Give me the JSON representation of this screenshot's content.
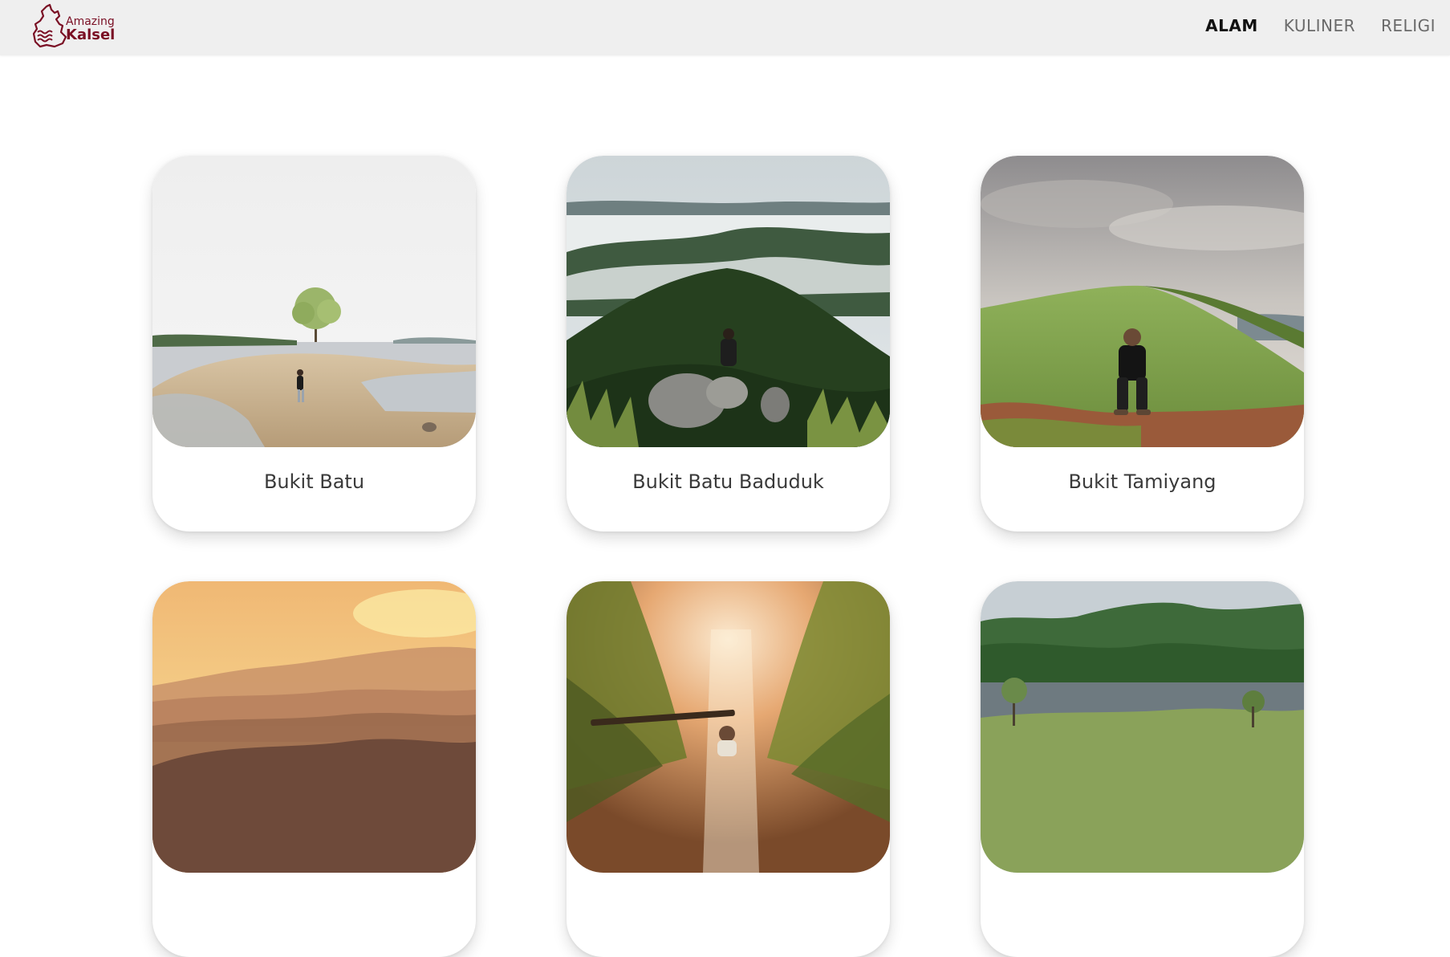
{
  "brand": {
    "line1": "Amazing",
    "line2": "Kalsel",
    "color": "#7a0f24",
    "icon": "kalsel-map-icon"
  },
  "nav": {
    "items": [
      {
        "label": "ALAM",
        "active": true
      },
      {
        "label": "KULINER",
        "active": false
      },
      {
        "label": "RELIGI",
        "active": false
      }
    ]
  },
  "cards": [
    {
      "title": "Bukit Batu",
      "image": "lake-tree-hiker-photo"
    },
    {
      "title": "Bukit Batu Baduduk",
      "image": "misty-forest-hills-photo"
    },
    {
      "title": "Bukit Tamiyang",
      "image": "grassy-hill-man-sitting-photo"
    },
    {
      "title": "",
      "image": "golden-sunrise-mountains-photo"
    },
    {
      "title": "",
      "image": "sunlit-waterfall-canyon-photo"
    },
    {
      "title": "",
      "image": "green-hills-lake-photo"
    }
  ]
}
